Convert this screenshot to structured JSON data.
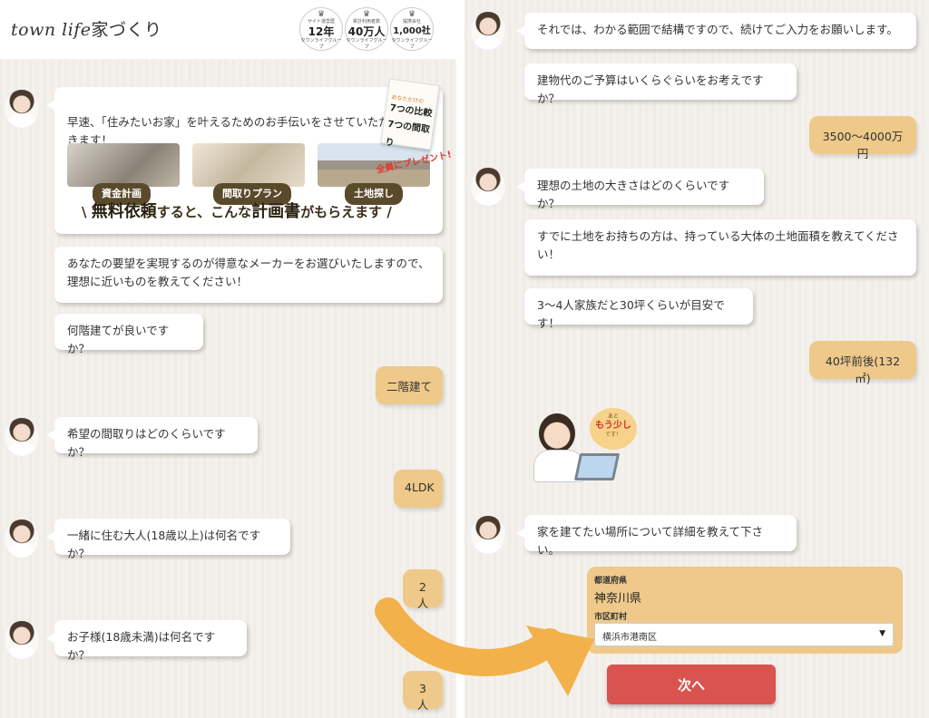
{
  "header": {
    "logo_latin": "town life",
    "logo_jp": "家づくり",
    "badges": [
      {
        "top": "サイト運営歴",
        "big": "12年",
        "bottom": "タウンライフグループ"
      },
      {
        "top": "累計利用者数",
        "big": "40万人",
        "bottom": "タウンライフグループ"
      },
      {
        "top": "提携会社",
        "big": "1,000社",
        "bottom": "タウンライフグループ"
      }
    ]
  },
  "promo": {
    "text": "早速、「住みたいお家」を叶えるためのお手伝いをさせていただきます！",
    "labels": [
      "資金計画",
      "間取りプラン",
      "土地探し"
    ],
    "tagline_pre": "無料依頼",
    "tagline_mid": "すると、こんな",
    "tagline_strong": "計画書",
    "tagline_post": "がもらえます",
    "book_top": "あなただけの",
    "book_line1": "7つの比較",
    "book_line2": "7つの間取り",
    "gift": "全員にプレゼント!"
  },
  "left_chat": {
    "q1": "あなたの要望を実現するのが得意なメーカーをお選びいたしますので、\n理想に近いものを教えてください！",
    "q2": "何階建てが良いですか？",
    "a2": "二階建て",
    "q3": "希望の間取りはどのくらいですか？",
    "a3": "4LDK",
    "q4": "一緒に住む大人(18歳以上)は何名ですか？",
    "a4": "2人",
    "q5": "お子様(18歳未満)は何名ですか？",
    "a5": "3人"
  },
  "right_chat": {
    "q1": "それでは、わかる範囲で結構ですので、続けてご入力をお願いします。",
    "q2": "建物代のご予算はいくらぐらいをお考えですか？",
    "a2": "3500〜4000万円",
    "q3": "理想の土地の大きさはどのくらいですか？",
    "q4": "すでに土地をお持ちの方は、持っている大体の土地面積を教えてください！",
    "q5": "3〜4人家族だと30坪くらいが目安です！",
    "a5": "40坪前後(132㎡)",
    "cloud_top": "あと",
    "cloud_main": "もう少し",
    "cloud_bottom": "です！",
    "q6": "家を建てたい場所について詳細を教えて下さい。"
  },
  "form": {
    "prefecture_label": "都道府県",
    "prefecture_value": "神奈川県",
    "city_label": "市区町村",
    "city_value": "横浜市港南区",
    "next_button": "次へ"
  },
  "colors": {
    "answer_bg": "#eec98a",
    "next_button": "#d9534f",
    "arrow": "#f2b14a",
    "label_bg": "#5a4a2c"
  }
}
